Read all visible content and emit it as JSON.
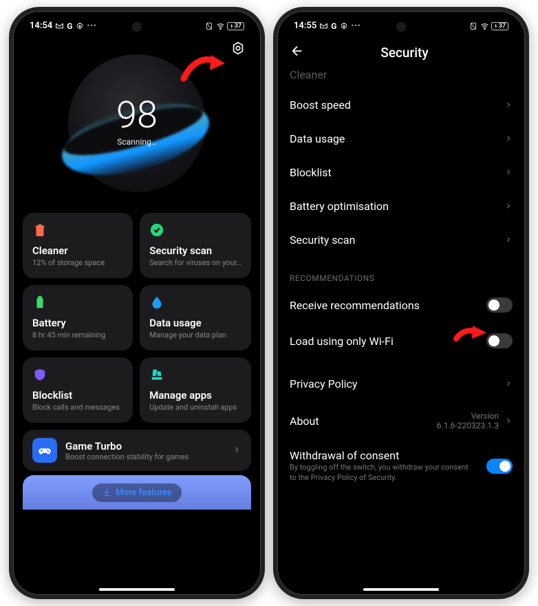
{
  "screen1": {
    "status": {
      "time": "14:54",
      "battery": "37"
    },
    "score": "98",
    "score_status": "Scanning…",
    "cards": {
      "cleaner": {
        "title": "Cleaner",
        "sub": "12% of storage space"
      },
      "secscan": {
        "title": "Security scan",
        "sub": "Search for viruses on your…"
      },
      "battery": {
        "title": "Battery",
        "sub": "8 hr 45 min  remaining"
      },
      "datausage": {
        "title": "Data usage",
        "sub": "Manage your data plan"
      },
      "blocklist": {
        "title": "Blocklist",
        "sub": "Block calls and messages"
      },
      "manageapps": {
        "title": "Manage apps",
        "sub": "Update and uninstall apps"
      }
    },
    "gameturbo": {
      "title": "Game Turbo",
      "sub": "Boost connection stability for games"
    },
    "more_features": "More features"
  },
  "screen2": {
    "status": {
      "time": "14:55",
      "battery": "37"
    },
    "title": "Security",
    "faded_top": "Cleaner",
    "items": {
      "boost": "Boost speed",
      "datausage": "Data usage",
      "blocklist": "Blocklist",
      "batteryopt": "Battery optimisation",
      "secscan": "Security scan"
    },
    "section_recs": "RECOMMENDATIONS",
    "toggle_recs": "Receive recommendations",
    "toggle_wifi": "Load using only Wi-Fi",
    "privacy": "Privacy Policy",
    "about": {
      "label": "About",
      "version_label": "Version",
      "version": "6.1.6-220323.1.3"
    },
    "withdrawal": {
      "title": "Withdrawal of consent",
      "sub": "By toggling off the switch, you withdraw your consent to the Privacy Policy of Security."
    }
  }
}
